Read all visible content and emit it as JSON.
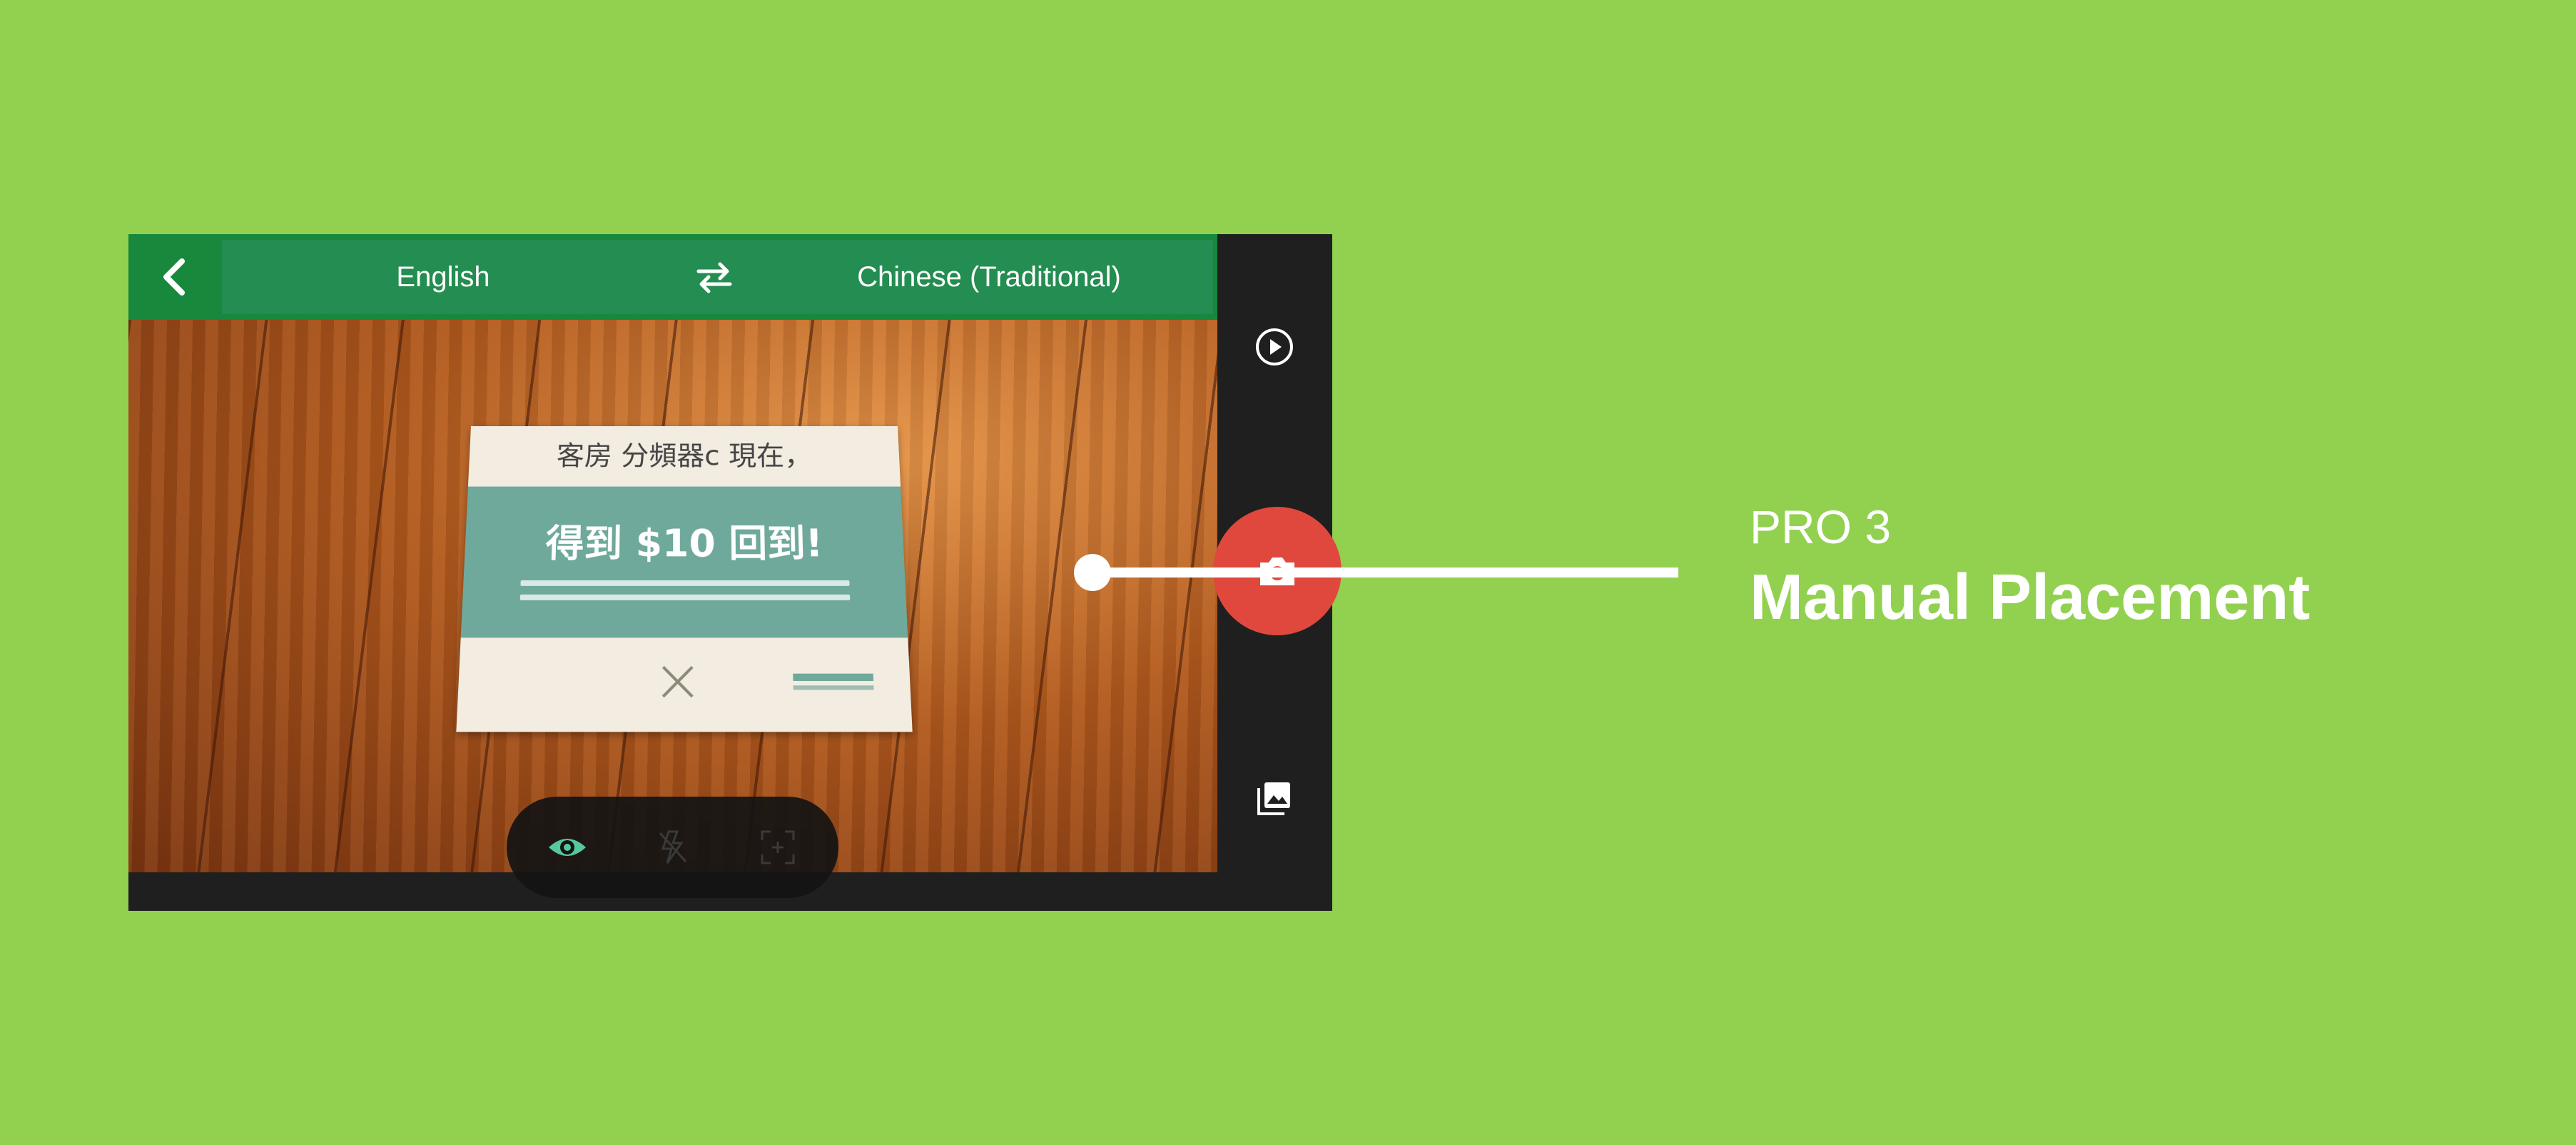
{
  "colors": {
    "background": "#92d150",
    "toolbar": "#17883c",
    "language_panel": "#248d51",
    "shutter": "#e0483e",
    "sidebar": "#1f1f1f",
    "eye_active": "#57c7a0"
  },
  "toolbar": {
    "back_icon": "chevron-left-icon",
    "source_language": "English",
    "swap_icon": "swap-arrows-icon",
    "target_language": "Chinese (Traditional)"
  },
  "sidebar": {
    "play_icon": "play-circle-icon",
    "shutter_icon": "camera-icon",
    "gallery_icon": "image-gallery-icon"
  },
  "modes": {
    "eye_icon": "eye-icon",
    "flash_icon": "flash-off-icon",
    "focus_icon": "focus-frame-icon"
  },
  "viewfinder": {
    "card_top_text": "客房 分頻器c 現在，",
    "card_main_text": "得到 $10 回到!"
  },
  "callout": {
    "kicker": "PRO 3",
    "title": "Manual Placement"
  }
}
